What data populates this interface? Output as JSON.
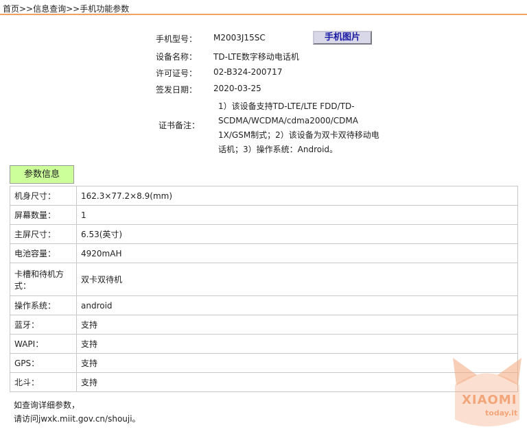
{
  "breadcrumb": "首页>>信息查询>>手机功能参数",
  "info": {
    "model_label": "手机型号：",
    "model_value": "M2003J15SC",
    "phone_pic_button": "手机图片",
    "device_label": "设备名称：",
    "device_value": "TD-LTE数字移动电话机",
    "license_label": "许可证号：",
    "license_value": "02-B324-200717",
    "date_label": "签发日期：",
    "date_value": "2020-03-25",
    "remark_label": "证书备注：",
    "remark_value": "1）该设备支持TD-LTE/LTE FDD/TD-SCDMA/WCDMA/cdma2000/CDMA 1X/GSM制式；2）该设备为双卡双待移动电话机；3）操作系统：Android。"
  },
  "params": {
    "tab_label": "参数信息",
    "rows": [
      {
        "key": "机身尺寸：",
        "value": "162.3×77.2×8.9(mm)"
      },
      {
        "key": "屏幕数量：",
        "value": "1"
      },
      {
        "key": "主屏尺寸：",
        "value": "6.53(英寸)"
      },
      {
        "key": "电池容量：",
        "value": "4920mAH"
      },
      {
        "key": "卡槽和待机方式：",
        "value": "双卡双待机"
      },
      {
        "key": "操作系统：",
        "value": "android"
      },
      {
        "key": "蓝牙：",
        "value": "支持"
      },
      {
        "key": "WAPI：",
        "value": "支持"
      },
      {
        "key": "GPS：",
        "value": "支持"
      },
      {
        "key": "北斗：",
        "value": "支持"
      }
    ]
  },
  "footnote": {
    "line1": "如查询详细参数，",
    "line2": "请访问jwxk.miit.gov.cn/shouji。"
  },
  "watermark": {
    "brand": "XIAOMI",
    "site": "today.it",
    "color": "#f3a57a"
  }
}
